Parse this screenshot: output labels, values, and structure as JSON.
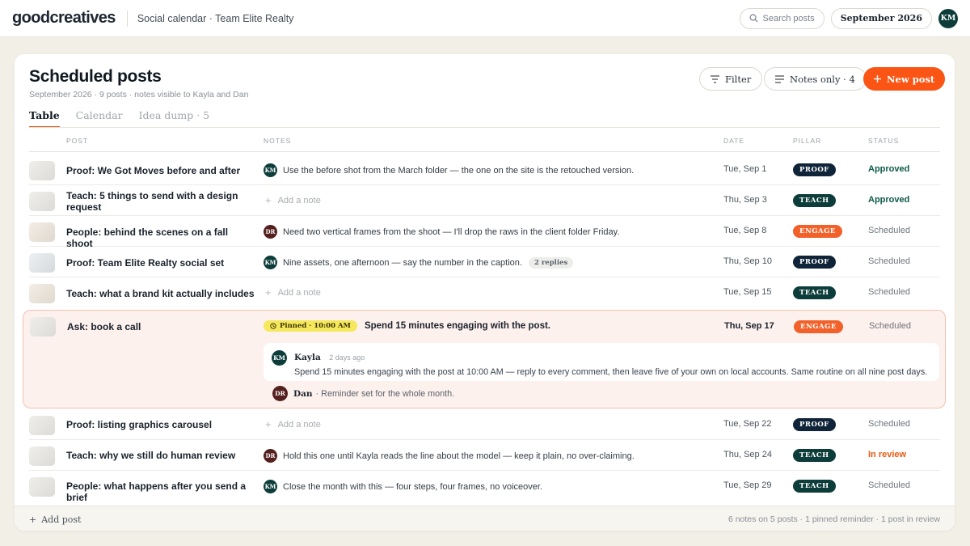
{
  "app": {
    "logo": "goodcreatives",
    "breadcrumb": "Social calendar · Team Elite Realty"
  },
  "topbar": {
    "search_placeholder": "Search posts",
    "month": "September 2026",
    "user_initials": "KM"
  },
  "page": {
    "title": "Scheduled posts",
    "subtitle": "September 2026 · 9 posts · notes visible to Kayla and Dan",
    "tabs": [
      "Table",
      "Calendar",
      "Idea dump · 5"
    ],
    "filter_label": "Filter",
    "notes_only_label": "Notes only · 4",
    "new_post_label": "New post"
  },
  "table": {
    "headers": {
      "post": "Post",
      "notes": "Notes",
      "date": "Date",
      "pillar": "Pillar",
      "status": "Status"
    },
    "add_note_label": "Add a note",
    "rows": [
      {
        "post": "Proof: We Got Moves before and after",
        "note_author": "KM",
        "note": "Use the before shot from the March folder — the one on the site is the retouched version.",
        "date": "Tue, Sep 1",
        "pillar": "PROOF",
        "status": "Approved"
      },
      {
        "post": "Teach: 5 things to send with a design request",
        "note_author": "",
        "note": "",
        "date": "Thu, Sep 3",
        "pillar": "TEACH",
        "status": "Approved"
      },
      {
        "post": "People: behind the scenes on a fall shoot",
        "note_author": "DR",
        "note": "Need two vertical frames from the shoot — I'll drop the raws in the client folder Friday.",
        "date": "Tue, Sep 8",
        "pillar": "ENGAGE",
        "status": "Scheduled"
      },
      {
        "post": "Proof: Team Elite Realty social set",
        "note_author": "KM",
        "note": "Nine assets, one afternoon — say the number in the caption.",
        "replies": "2 replies",
        "date": "Thu, Sep 10",
        "pillar": "PROOF",
        "status": "Scheduled"
      },
      {
        "post": "Teach: what a brand kit actually includes",
        "note_author": "",
        "note": "",
        "date": "Tue, Sep 15",
        "pillar": "TEACH",
        "status": "Scheduled"
      },
      {
        "post": "Ask: book a call",
        "pinned_label": "Pinned · 10:00 AM",
        "note": "Spend 15 minutes engaging with the post.",
        "date": "Thu, Sep 17",
        "pillar": "ENGAGE",
        "status": "Scheduled",
        "comment": {
          "author": "Kayla",
          "initials": "KM",
          "time": "2 days ago",
          "text": "Spend 15 minutes engaging with the post at 10:00 AM — reply to every comment, then leave five of your own on local accounts. Same routine on all nine post days."
        },
        "reply": {
          "author": "Dan",
          "initials": "DR",
          "text": "· Reminder set for the whole month."
        }
      },
      {
        "post": "Proof: listing graphics carousel",
        "note_author": "",
        "note": "",
        "date": "Tue, Sep 22",
        "pillar": "PROOF",
        "status": "Scheduled"
      },
      {
        "post": "Teach: why we still do human review",
        "note_author": "DR",
        "note": "Hold this one until Kayla reads the line about the model — keep it plain, no over-claiming.",
        "date": "Thu, Sep 24",
        "pillar": "TEACH",
        "status": "In review"
      },
      {
        "post": "People: what happens after you send a brief",
        "note_author": "KM",
        "note": "Close the month with this — four steps, four frames, no voiceover.",
        "date": "Tue, Sep 29",
        "pillar": "TEACH",
        "status": "Scheduled"
      }
    ]
  },
  "footer": {
    "add_post": "Add post",
    "stats": "6 notes on 5 posts · 1 pinned reminder · 1 post in review"
  }
}
